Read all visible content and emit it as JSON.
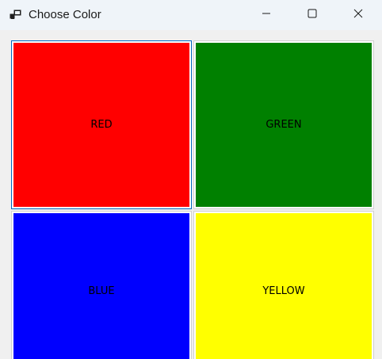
{
  "window": {
    "title": "Choose Color",
    "icon": "app-window-icon"
  },
  "caption_buttons": {
    "minimize_icon": "minimize-icon",
    "maximize_icon": "maximize-icon",
    "close_icon": "close-icon"
  },
  "color_buttons": [
    {
      "label": "RED",
      "color": "#ff0000"
    },
    {
      "label": "GREEN",
      "color": "#008000"
    },
    {
      "label": "BLUE",
      "color": "#0000ff"
    },
    {
      "label": "YELLOW",
      "color": "#ffff00"
    }
  ]
}
